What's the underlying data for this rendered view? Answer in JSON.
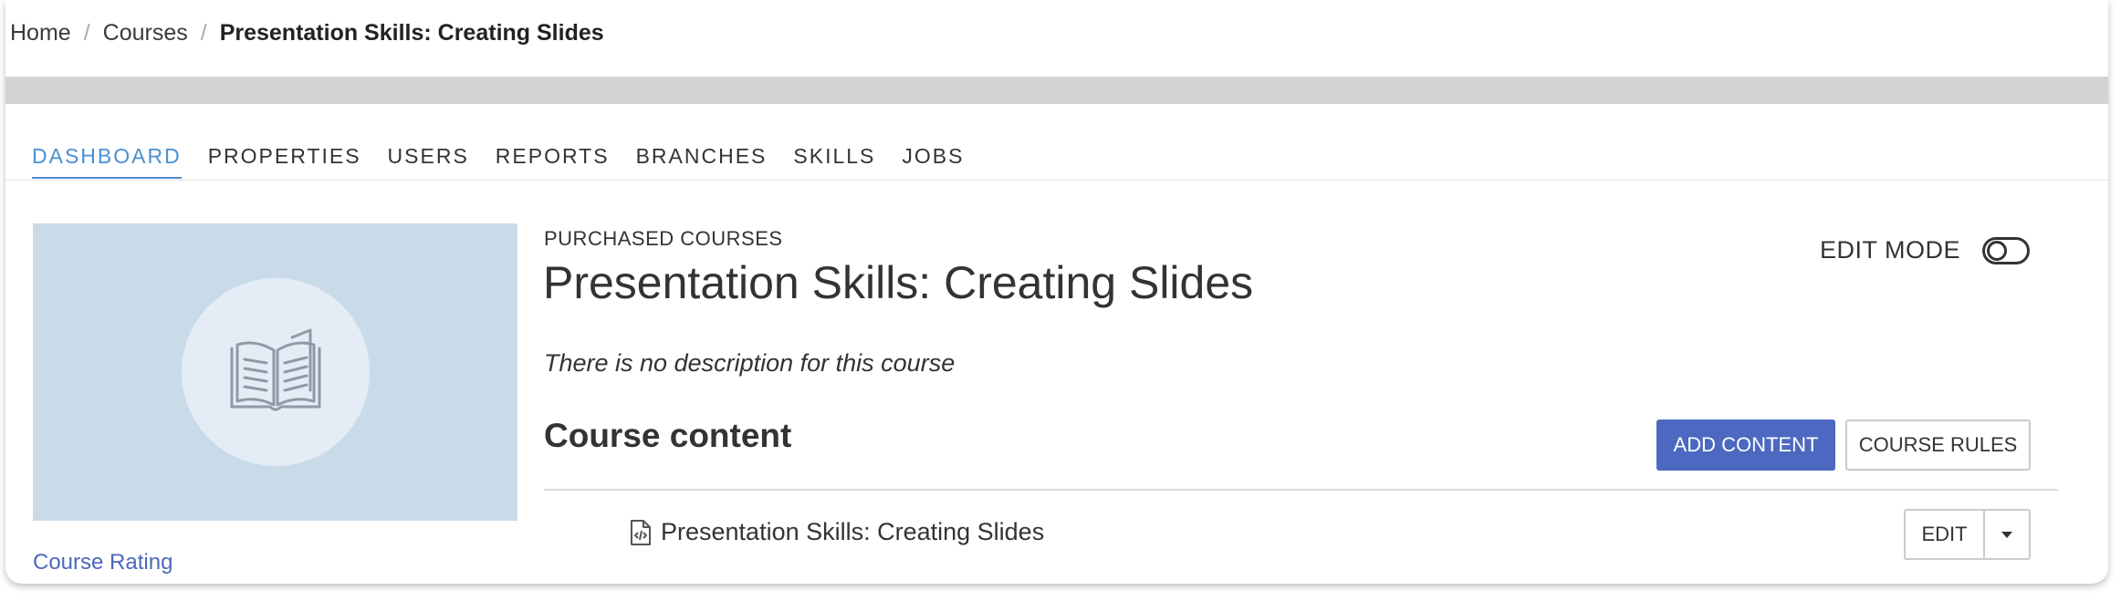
{
  "breadcrumb": {
    "home": "Home",
    "courses": "Courses",
    "current": "Presentation Skills: Creating Slides",
    "separator": "/"
  },
  "tabs": [
    {
      "label": "DASHBOARD",
      "active": true
    },
    {
      "label": "PROPERTIES",
      "active": false
    },
    {
      "label": "USERS",
      "active": false
    },
    {
      "label": "REPORTS",
      "active": false
    },
    {
      "label": "BRANCHES",
      "active": false
    },
    {
      "label": "SKILLS",
      "active": false
    },
    {
      "label": "JOBS",
      "active": false
    }
  ],
  "course": {
    "image_icon": "open-book-icon",
    "rating_link": "Course Rating",
    "kicker": "PURCHASED COURSES",
    "title": "Presentation Skills: Creating Slides",
    "description": "There is no description for this course"
  },
  "edit_mode": {
    "label": "EDIT MODE",
    "enabled": false
  },
  "content": {
    "heading": "Course content",
    "add_button": "ADD CONTENT",
    "rules_button": "COURSE RULES",
    "units": [
      {
        "icon": "code-file-icon",
        "title": "Presentation Skills: Creating Slides",
        "edit_label": "EDIT"
      }
    ]
  },
  "colors": {
    "accent_tab": "#4a8fd0",
    "primary_button": "#4c68c0",
    "link": "#4c68b8",
    "image_bg": "#c9dbe9"
  }
}
